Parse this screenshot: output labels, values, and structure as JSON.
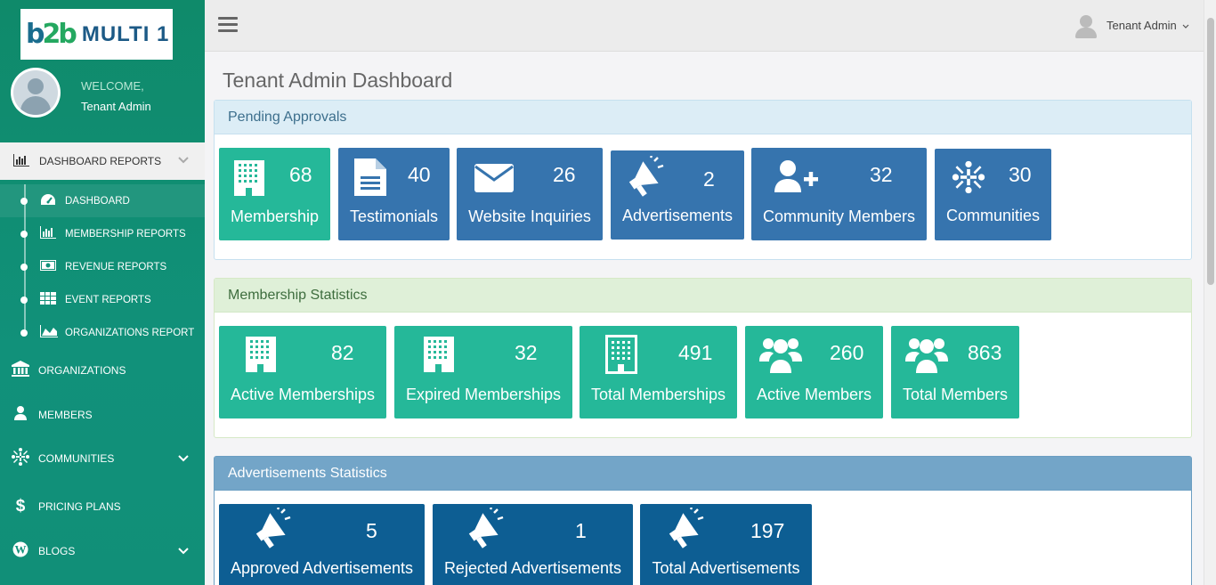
{
  "brand": {
    "logo_mark_a": "b",
    "logo_mark_b": "2b",
    "logo_text": "MULTI 1"
  },
  "profile": {
    "welcome": "WELCOME,",
    "name": "Tenant Admin"
  },
  "sidebar": {
    "section": "DASHBOARD REPORTS",
    "sub_items": [
      {
        "label": "DASHBOARD",
        "icon": "tachometer-icon"
      },
      {
        "label": "MEMBERSHIP REPORTS",
        "icon": "bar-chart-icon"
      },
      {
        "label": "REVENUE REPORTS",
        "icon": "money-icon"
      },
      {
        "label": "EVENT REPORTS",
        "icon": "grid-icon"
      },
      {
        "label": "ORGANIZATIONS REPORT",
        "icon": "area-chart-icon"
      }
    ],
    "items": [
      {
        "label": "ORGANIZATIONS",
        "icon": "bank-icon"
      },
      {
        "label": "MEMBERS",
        "icon": "user-icon"
      },
      {
        "label": "COMMUNITIES",
        "icon": "community-icon"
      },
      {
        "label": "PRICING PLANS",
        "icon": "dollar-icon"
      },
      {
        "label": "BLOGS",
        "icon": "wordpress-icon"
      }
    ]
  },
  "topbar": {
    "user": "Tenant Admin"
  },
  "page": {
    "title": "Tenant Admin Dashboard"
  },
  "pending": {
    "title": "Pending Approvals",
    "tiles": [
      {
        "value": "68",
        "label": "Membership",
        "icon": "building-icon",
        "color": "#25b899"
      },
      {
        "value": "40",
        "label": "Testimonials",
        "icon": "document-icon",
        "color": "#3674ae"
      },
      {
        "value": "26",
        "label": "Website Inquiries",
        "icon": "envelope-icon",
        "color": "#3674ae"
      },
      {
        "value": "2",
        "label": "Advertisements",
        "icon": "megaphone-icon",
        "color": "#3674ae"
      },
      {
        "value": "32",
        "label": "Community Members",
        "icon": "user-plus-icon",
        "color": "#3674ae"
      },
      {
        "value": "30",
        "label": "Communities",
        "icon": "community-icon",
        "color": "#3674ae"
      }
    ]
  },
  "membership": {
    "title": "Membership Statistics",
    "tiles": [
      {
        "value": "82",
        "label": "Active Memberships",
        "icon": "building-icon"
      },
      {
        "value": "32",
        "label": "Expired Memberships",
        "icon": "building-icon"
      },
      {
        "value": "491",
        "label": "Total Memberships",
        "icon": "building-icon"
      },
      {
        "value": "260",
        "label": "Active Members",
        "icon": "users-icon"
      },
      {
        "value": "863",
        "label": "Total Members",
        "icon": "users-icon"
      }
    ]
  },
  "ads": {
    "title": "Advertisements Statistics",
    "tiles": [
      {
        "value": "5",
        "label": "Approved Advertisements",
        "icon": "megaphone-icon"
      },
      {
        "value": "1",
        "label": "Rejected Advertisements",
        "icon": "megaphone-icon"
      },
      {
        "value": "197",
        "label": "Total Advertisements",
        "icon": "megaphone-icon"
      }
    ]
  }
}
